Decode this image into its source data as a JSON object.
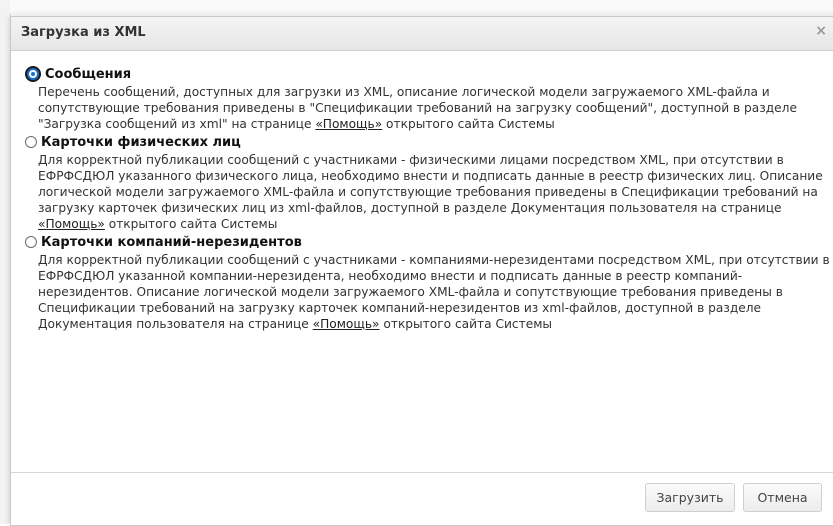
{
  "dialog": {
    "title": "Загрузка из XML",
    "close_glyph": "×"
  },
  "options": [
    {
      "label": "Сообщения",
      "checked": true,
      "desc_before": "Перечень сообщений, доступных для загрузки из XML, описание логической модели загружаемого XML-файла и сопутствующие требования приведены в \"Спецификации требований на загрузку сообщений\", доступной в разделе \"Загрузка сообщений из xml\" на странице ",
      "link": "«Помощь»",
      "desc_after": " открытого сайта Системы"
    },
    {
      "label": "Карточки физических лиц",
      "checked": false,
      "desc_before": "Для корректной публикации сообщений с участниками - физическими лицами посредством XML, при отсутствии в ЕФРФСДЮЛ указанного физического лица, необходимо внести и подписать данные в реестр физических лиц. Описание логической модели загружаемого XML-файла и сопутствующие требования приведены в Спецификации требований на загрузку карточек физических лиц из xml-файлов, доступной в разделе Документация пользователя на странице ",
      "link": "«Помощь»",
      "desc_after": " открытого сайта Системы"
    },
    {
      "label": "Карточки компаний-нерезидентов",
      "checked": false,
      "desc_before": "Для корректной публикации сообщений с участниками - компаниями-нерезидентами посредством XML, при отсутствии в ЕФРФСДЮЛ указанной компании-нерезидента, необходимо внести и подписать данные в реестр компаний-нерезидентов. Описание логической модели загружаемого XML-файла и сопутствующие требования приведены в Спецификации требований на загрузку карточек компаний-нерезидентов из xml-файлов, доступной в разделе Документация пользователя на странице ",
      "link": "«Помощь»",
      "desc_after": " открытого сайта Системы"
    }
  ],
  "buttons": {
    "load": "Загрузить",
    "cancel": "Отмена"
  },
  "colors": {
    "radio_selected": "#1a6fc9",
    "title_bar": "#e9e9e9"
  }
}
